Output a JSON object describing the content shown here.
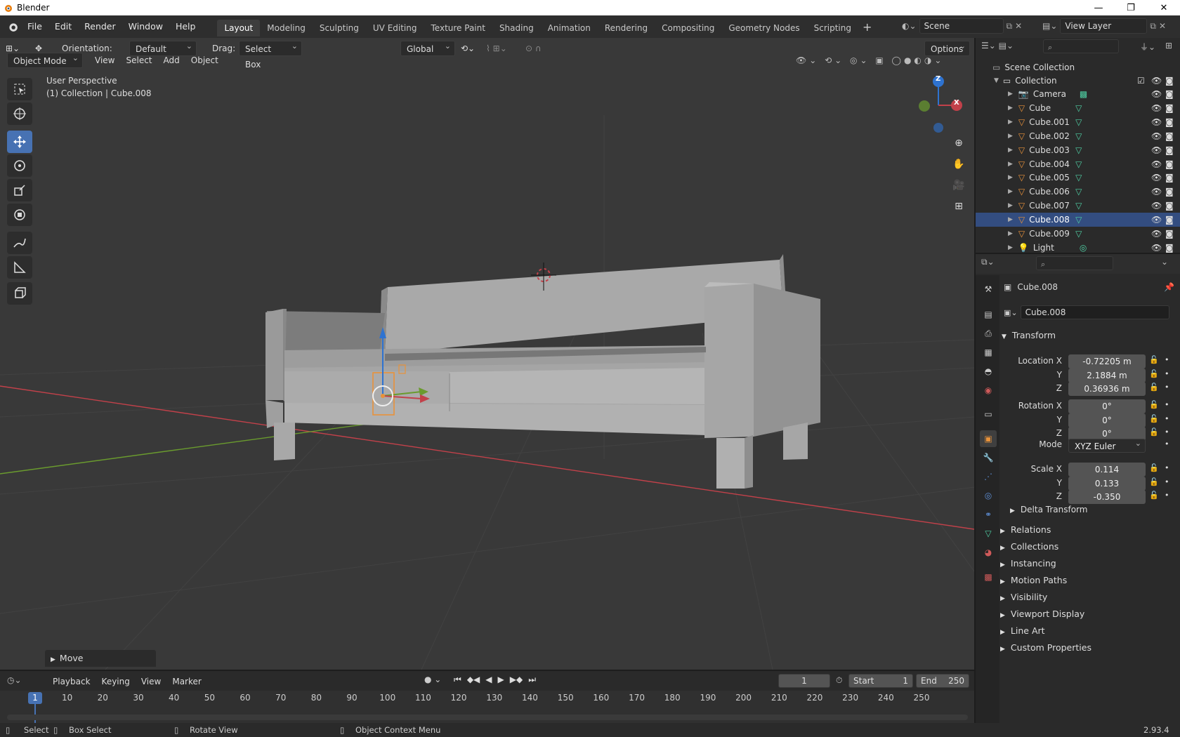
{
  "window": {
    "title": "Blender"
  },
  "menu": [
    "File",
    "Edit",
    "Render",
    "Window",
    "Help"
  ],
  "workspaces": [
    "Layout",
    "Modeling",
    "Sculpting",
    "UV Editing",
    "Texture Paint",
    "Shading",
    "Animation",
    "Rendering",
    "Compositing",
    "Geometry Nodes",
    "Scripting"
  ],
  "scene": {
    "name": "Scene",
    "view_layer": "View Layer"
  },
  "toolbar": {
    "orientation_label": "Orientation:",
    "orientation_value": "Default",
    "drag_label": "Drag:",
    "drag_value": "Select Box",
    "transform_orientation": "Global",
    "options": "Options"
  },
  "viewport": {
    "mode": "Object Mode",
    "menus": [
      "View",
      "Select",
      "Add",
      "Object"
    ],
    "overlay_line1": "User Perspective",
    "overlay_line2": "(1) Collection | Cube.008",
    "last_operator": "Move",
    "gizmo": {
      "z": "Z",
      "x": "X"
    }
  },
  "outliner": {
    "root": "Scene Collection",
    "collection": "Collection",
    "items": [
      {
        "name": "Camera",
        "type": "camera",
        "selected": false
      },
      {
        "name": "Cube",
        "type": "mesh",
        "selected": false
      },
      {
        "name": "Cube.001",
        "type": "mesh",
        "selected": false
      },
      {
        "name": "Cube.002",
        "type": "mesh",
        "selected": false
      },
      {
        "name": "Cube.003",
        "type": "mesh",
        "selected": false
      },
      {
        "name": "Cube.004",
        "type": "mesh",
        "selected": false
      },
      {
        "name": "Cube.005",
        "type": "mesh",
        "selected": false
      },
      {
        "name": "Cube.006",
        "type": "mesh",
        "selected": false
      },
      {
        "name": "Cube.007",
        "type": "mesh",
        "selected": false
      },
      {
        "name": "Cube.008",
        "type": "mesh",
        "selected": true
      },
      {
        "name": "Cube.009",
        "type": "mesh",
        "selected": false
      },
      {
        "name": "Light",
        "type": "light",
        "selected": false
      }
    ]
  },
  "properties": {
    "object_name": "Cube.008",
    "data_name": "Cube.008",
    "transform_header": "Transform",
    "location_label": "Location X",
    "location": [
      "-0.72205 m",
      "2.1884 m",
      "0.36936 m"
    ],
    "rotation_label": "Rotation X",
    "rotation": [
      "0°",
      "0°",
      "0°"
    ],
    "mode_label": "Mode",
    "mode_value": "XYZ Euler",
    "scale_label": "Scale X",
    "scale": [
      "0.114",
      "0.133",
      "-0.350"
    ],
    "axis_y": "Y",
    "axis_z": "Z",
    "delta": "Delta Transform",
    "panels": [
      "Relations",
      "Collections",
      "Instancing",
      "Motion Paths",
      "Visibility",
      "Viewport Display",
      "Line Art",
      "Custom Properties"
    ]
  },
  "timeline": {
    "menus": [
      "Playback",
      "Keying",
      "View",
      "Marker"
    ],
    "current_frame": "1",
    "start_label": "Start",
    "start": "1",
    "end_label": "End",
    "end": "250",
    "ruler": [
      "1",
      "10",
      "20",
      "30",
      "40",
      "50",
      "60",
      "70",
      "80",
      "90",
      "100",
      "110",
      "120",
      "130",
      "140",
      "150",
      "160",
      "170",
      "180",
      "190",
      "200",
      "210",
      "220",
      "230",
      "240",
      "250"
    ]
  },
  "status": {
    "select": "Select",
    "box_select": "Box Select",
    "rotate": "Rotate View",
    "context": "Object Context Menu",
    "version": "2.93.4"
  },
  "colors": {
    "accent": "#4772b3",
    "selection": "#334d80",
    "header": "#2e2e2e",
    "viewport": "#393939",
    "x_axis": "#c2414a",
    "y_axis": "#6a9b2e",
    "z_axis": "#2e73d1",
    "object_orange": "#e8923a"
  }
}
